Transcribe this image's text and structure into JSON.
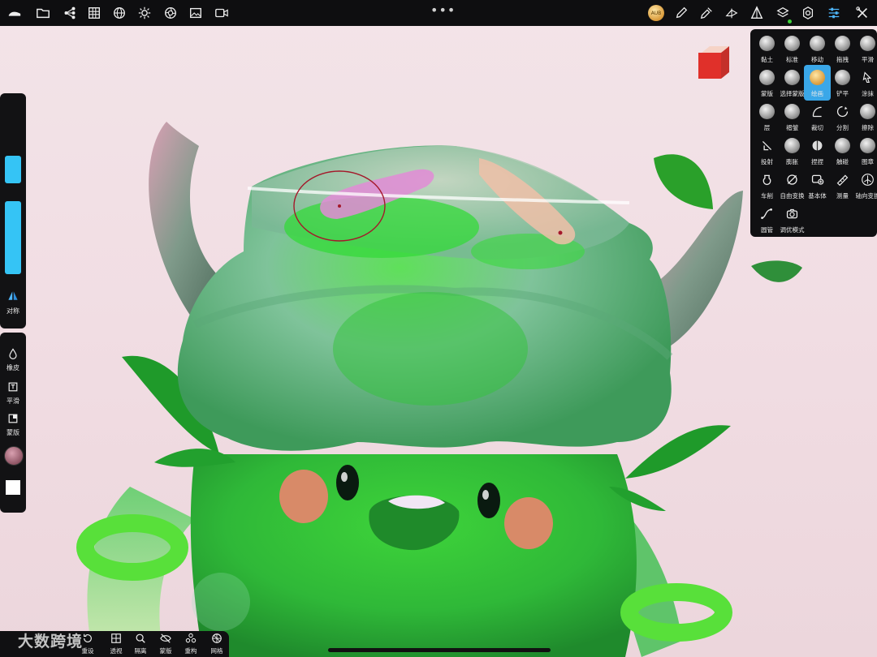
{
  "topbar": {
    "menu_dots": "•••",
    "left_icons": [
      "brand-icon",
      "folder-icon",
      "scene-tree-icon",
      "grid-icon",
      "globe-icon",
      "sun-icon",
      "camera-lens-icon",
      "image-icon",
      "video-icon"
    ],
    "right_icons": [
      "brush-thumbnail-icon",
      "pen-icon",
      "pipette-icon",
      "symmetry-tool-icon",
      "triangle-icon",
      "layers-icon",
      "gear-icon",
      "sliders-icon",
      "tools-icon"
    ],
    "thumb_text": "AUB"
  },
  "left_panel": {
    "symmetry_label": "对称",
    "items": [
      {
        "label": "橡皮",
        "icon": "drop-icon"
      },
      {
        "label": "平滑",
        "icon": "smooth-icon"
      },
      {
        "label": "蒙版",
        "icon": "mask-icon"
      }
    ]
  },
  "tools": [
    {
      "label": "黏土"
    },
    {
      "label": "标准"
    },
    {
      "label": "移动"
    },
    {
      "label": "拖拽"
    },
    {
      "label": "平滑"
    },
    {
      "label": "蒙版"
    },
    {
      "label": "选择蒙版"
    },
    {
      "label": "绘画",
      "active": true
    },
    {
      "label": "铲平"
    },
    {
      "label": "涂抹"
    },
    {
      "label": "层"
    },
    {
      "label": "褶皱"
    },
    {
      "label": "裁切"
    },
    {
      "label": "分割"
    },
    {
      "label": "擦除"
    },
    {
      "label": "投射"
    },
    {
      "label": "膨胀"
    },
    {
      "label": "捏捏"
    },
    {
      "label": "触碰"
    },
    {
      "label": "图章"
    },
    {
      "label": "车削"
    },
    {
      "label": "自由变换"
    },
    {
      "label": "基本体"
    },
    {
      "label": "测量"
    },
    {
      "label": "轴向变换"
    },
    {
      "label": "圆管"
    },
    {
      "label": "调优模式"
    }
  ],
  "bottom_bar": {
    "watermark": "大数跨境",
    "items": [
      {
        "label": "重设"
      },
      {
        "label": "透视"
      },
      {
        "label": "隔离"
      },
      {
        "label": "蒙版"
      },
      {
        "label": "重构"
      },
      {
        "label": "网格"
      }
    ]
  },
  "colors": {
    "accent": "#35c4f5",
    "panel_bg": "#101012",
    "active_tool": "#3aa7e8",
    "background": "#f1dde3"
  }
}
